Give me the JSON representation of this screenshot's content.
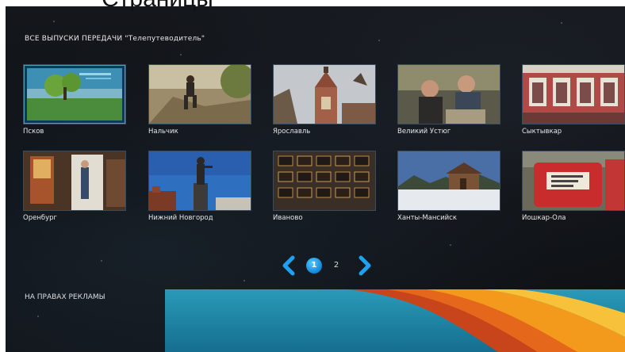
{
  "page_caption": "Страницы",
  "section": {
    "title": "ВСЕ ВЫПУСКИ ПЕРЕДАЧИ \"Телепутеводитель\""
  },
  "episodes": [
    {
      "title": "Псков",
      "thumbnail": "pskov-landscape-image"
    },
    {
      "title": "Нальчик",
      "thumbnail": "nalchik-man-on-rocks-image"
    },
    {
      "title": "Ярославль",
      "thumbnail": "yaroslavl-church-tower-image"
    },
    {
      "title": "Великий Устюг",
      "thumbnail": "veliky-ustyug-two-men-image"
    },
    {
      "title": "Сыктывкар",
      "thumbnail": "syktyvkar-building-facade-image"
    },
    {
      "title": "Оренбург",
      "thumbnail": "orenburg-doorway-image"
    },
    {
      "title": "Нижний Новгород",
      "thumbnail": "nizhny-novgorod-monument-image"
    },
    {
      "title": "Иваново",
      "thumbnail": "ivanovo-lacquer-boxes-image"
    },
    {
      "title": "Ханты-Мансийск",
      "thumbnail": "khanty-mansiysk-wooden-house-image"
    },
    {
      "title": "Йошкар-Ола",
      "thumbnail": "yoshkar-ola-red-mailbox-image"
    }
  ],
  "pagination": {
    "current": "1",
    "next_page": "2",
    "prev_icon": "chevron-left-icon",
    "next_icon": "chevron-right-icon"
  },
  "ad": {
    "label": "НА ПРАВАХ РЕКЛАМЫ",
    "colors": {
      "banner_bg": "#1f8aa6",
      "wave_orange": "#f39a1c",
      "wave_red": "#c8441a"
    }
  },
  "colors": {
    "accent": "#1590e0",
    "background": "#111418",
    "text": "#e6e6e6"
  }
}
